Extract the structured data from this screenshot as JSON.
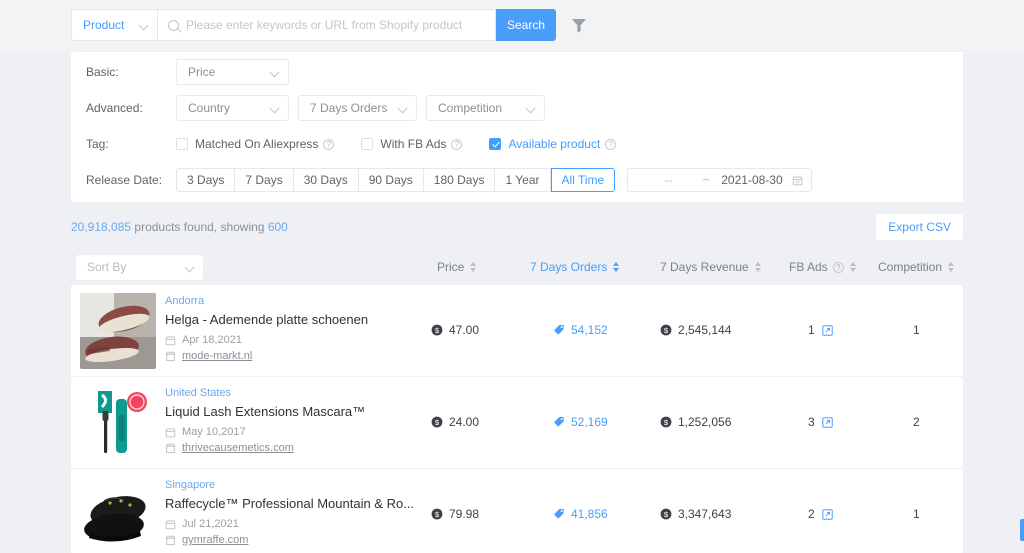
{
  "search": {
    "type_label": "Product",
    "placeholder": "Please enter keywords or URL from Shopify product",
    "value": "",
    "button_label": "Search",
    "filter_icon": "funnel-icon"
  },
  "filters": {
    "basic": {
      "label": "Basic:",
      "price_select": "Price"
    },
    "advanced": {
      "label": "Advanced:",
      "country_select": "Country",
      "orders_select": "7 Days Orders",
      "competition_select": "Competition"
    },
    "tag": {
      "label": "Tag:",
      "items": [
        {
          "label": "Matched On Aliexpress",
          "checked": false
        },
        {
          "label": "With FB Ads",
          "checked": false
        },
        {
          "label": "Available product",
          "checked": true
        }
      ]
    },
    "release_date": {
      "label": "Release Date:",
      "options": [
        "3 Days",
        "7 Days",
        "30 Days",
        "90 Days",
        "180 Days",
        "1 Year",
        "All Time"
      ],
      "selected": "All Time",
      "range_start": "--",
      "range_sep": "~",
      "range_end": "2021-08-30"
    }
  },
  "results": {
    "count": "20,918,085",
    "middle_text": " products found, showing ",
    "showing": "600",
    "export_label": "Export CSV"
  },
  "table": {
    "sort_by_placeholder": "Sort By",
    "columns": [
      {
        "label": "Price",
        "active": false
      },
      {
        "label": "7 Days Orders",
        "active": true
      },
      {
        "label": "7 Days Revenue",
        "active": false
      },
      {
        "label": "FB Ads",
        "active": false,
        "help": true
      },
      {
        "label": "Competition",
        "active": false
      }
    ],
    "rows": [
      {
        "country": "Andorra",
        "name": "Helga - Ademende platte schoenen",
        "date": "Apr 18,2021",
        "domain": "mode-markt.nl",
        "price": "47.00",
        "orders": "54,152",
        "revenue": "2,545,144",
        "fb_ads": "1",
        "competition": "1"
      },
      {
        "country": "United States",
        "name": "Liquid Lash Extensions Mascara™",
        "date": "May 10,2017",
        "domain": "thrivecausemetics.com",
        "price": "24.00",
        "orders": "52,169",
        "revenue": "1,252,056",
        "fb_ads": "3",
        "competition": "2"
      },
      {
        "country": "Singapore",
        "name": "Raffecycle™ Professional Mountain & Ro...",
        "date": "Jul 21,2021",
        "domain": "gymraffe.com",
        "price": "79.98",
        "orders": "41,856",
        "revenue": "3,347,643",
        "fb_ads": "2",
        "competition": "1"
      }
    ]
  },
  "colors": {
    "accent": "#4a9df8",
    "link": "#6aa9f0",
    "page_bg": "#eef0f3",
    "panel_bg": "#ffffff"
  }
}
